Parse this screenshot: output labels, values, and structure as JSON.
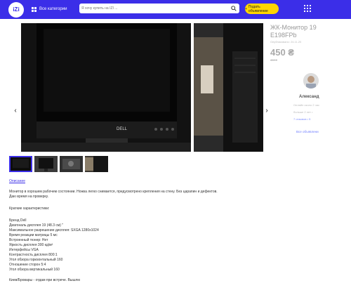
{
  "header": {
    "logo_text": "iZi",
    "categories_label": "Все категории",
    "search_placeholder": "Я хочу купить на IZI ...",
    "post_button_label": "Подать объявление",
    "post_button_icon": "plus-icon"
  },
  "listing": {
    "title": "ЖК-Монитор 19\nE198FPb",
    "published": "Опубликовано: 24.11.20",
    "price": "450 ₴",
    "price_note": "450 ₴"
  },
  "seller": {
    "name": "Александ",
    "online": "Онлайн около 2 час",
    "since": "больше 2 лет •",
    "reviews": "7 отзывов  •  5",
    "all_ads_label": "Все объявлени"
  },
  "description": {
    "tab_label": "Описание",
    "intro": [
      "Монитор в хорошем рабочем состоянии. Ножка легко снимается, предусмотрено крепления на стену. Без царапин и дефектов.",
      "Даю время на проверку."
    ],
    "specs_heading": "Краткие характеристики:",
    "specs": [
      "Бренд Dell",
      "Диагональ дисплея 19 (48.3 см) \"",
      "Максимальное разрешение дисплея: SXGA 1280x1024",
      "Время реакции матрицы 5 мс",
      "Встроенный тюнер: Нет",
      "Яркость дисплея 300 кд/м²",
      "Интерфейсы VGA",
      "Контрастность дисплея 800:1",
      "Угол обзора горизонтальный 160",
      "Отношение сторон 5:4",
      "Угол обзора вертикальный 160"
    ],
    "footer": "Киев/Бровары - отдам при встрече. Вышлю"
  },
  "colors": {
    "brand": "#3b2ee8",
    "accent": "#ffd600"
  },
  "icons": {
    "logo": "izi-logo",
    "categories": "grid-icon",
    "search": "search-icon",
    "apps": "apps-grid-icon",
    "prev": "chevron-left-icon",
    "next": "chevron-right-icon"
  }
}
